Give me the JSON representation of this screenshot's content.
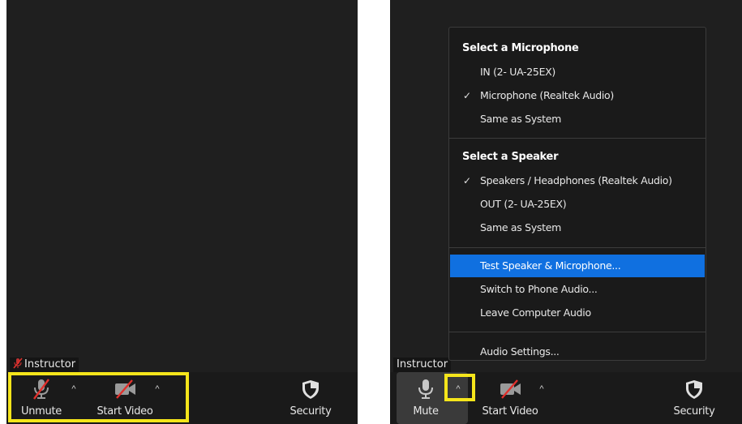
{
  "left": {
    "participant_name": "Instructor",
    "toolbar": {
      "unmute_label": "Unmute",
      "start_video_label": "Start Video",
      "security_label": "Security"
    }
  },
  "right": {
    "participant_name": "Instructor",
    "toolbar": {
      "mute_label": "Mute",
      "start_video_label": "Start Video",
      "security_label": "Security"
    },
    "audio_menu": {
      "microphone_heading": "Select a Microphone",
      "microphones": [
        {
          "label": "IN (2- UA-25EX)",
          "checked": false
        },
        {
          "label": "Microphone (Realtek Audio)",
          "checked": true
        },
        {
          "label": "Same as System",
          "checked": false
        }
      ],
      "speaker_heading": "Select a Speaker",
      "speakers": [
        {
          "label": "Speakers / Headphones (Realtek Audio)",
          "checked": true
        },
        {
          "label": "OUT (2- UA-25EX)",
          "checked": false
        },
        {
          "label": "Same as System",
          "checked": false
        }
      ],
      "actions": [
        {
          "label": "Test Speaker & Microphone...",
          "active": true
        },
        {
          "label": "Switch to Phone Audio...",
          "active": false
        },
        {
          "label": "Leave Computer Audio",
          "active": false
        }
      ],
      "settings_label": "Audio Settings...",
      "check_glyph": "✓"
    }
  },
  "colors": {
    "highlight": "#f5e51b",
    "menu_active": "#1070e0",
    "muted_red": "#e0302c",
    "background": "#1f1f1f"
  },
  "icons": {
    "chevron": "^"
  }
}
